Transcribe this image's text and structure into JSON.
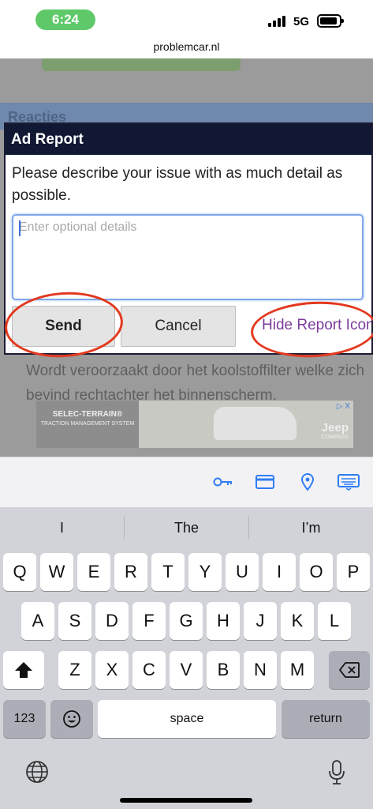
{
  "status_bar": {
    "time": "6:24",
    "network": "5G"
  },
  "browser": {
    "url": "problemcar.nl"
  },
  "page": {
    "section_heading": "Reacties",
    "body_text": "Wordt veroorzaakt door het koolstoffilter welke zich bevind rechtachter het binnenscherm.",
    "ad": {
      "headline": "SELEC-TERRAIN®",
      "subline": "TRACTION MANAGEMENT SYSTEM",
      "brand": "Jeep",
      "model": "COMPASS",
      "choices_label": "▷ X"
    }
  },
  "modal": {
    "title": "Ad Report",
    "description": "Please describe your issue with as much detail as possible.",
    "details_placeholder": "Enter optional details",
    "send_label": "Send",
    "cancel_label": "Cancel",
    "hide_label": "Hide Report Icon"
  },
  "accessory_bar": {
    "icons": [
      "key-icon",
      "credit-card-icon",
      "location-icon",
      "keyboard-icon"
    ]
  },
  "keyboard": {
    "suggestions": [
      "I",
      "The",
      "I’m"
    ],
    "row1": [
      "Q",
      "W",
      "E",
      "R",
      "T",
      "Y",
      "U",
      "I",
      "O",
      "P"
    ],
    "row2": [
      "A",
      "S",
      "D",
      "F",
      "G",
      "H",
      "J",
      "K",
      "L"
    ],
    "row3": [
      "Z",
      "X",
      "C",
      "V",
      "B",
      "N",
      "M"
    ],
    "numbers_label": "123",
    "space_label": "space",
    "return_label": "return"
  },
  "colors": {
    "accent": "#2f7cf6",
    "modal_header": "#111833",
    "link": "#7b3c9a",
    "annotation": "#e2391f"
  }
}
